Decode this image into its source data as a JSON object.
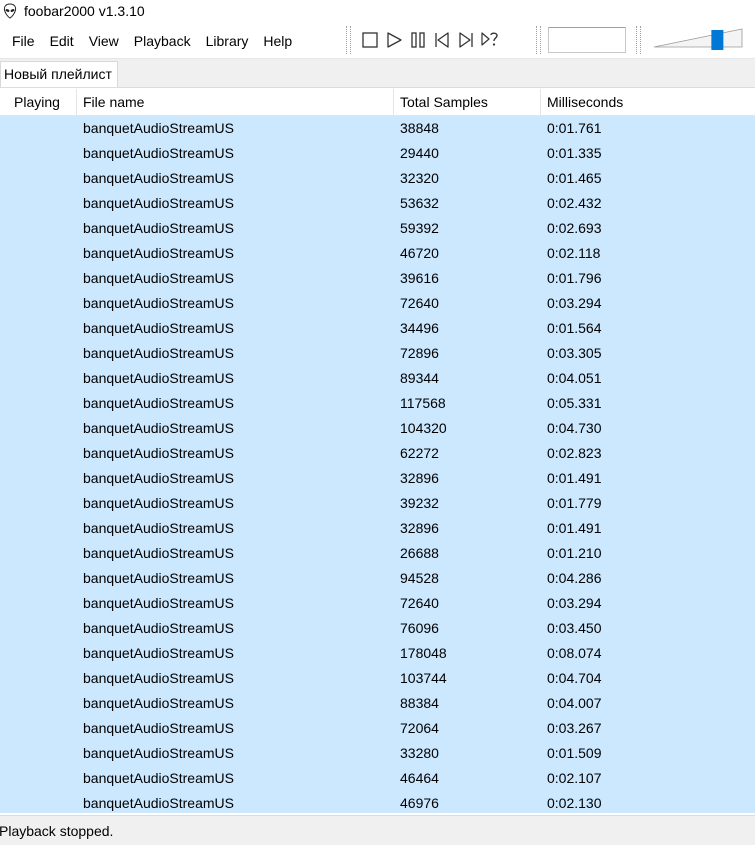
{
  "window": {
    "title": "foobar2000 v1.3.10",
    "icon": "alien-logo-icon"
  },
  "menu": {
    "items": [
      "File",
      "Edit",
      "View",
      "Playback",
      "Library",
      "Help"
    ]
  },
  "toolbar": {
    "buttons": [
      "stop-icon",
      "play-icon",
      "pause-icon",
      "previous-icon",
      "next-icon",
      "random-icon"
    ],
    "volume_level_percent": 72
  },
  "tabs": [
    {
      "label": "Новый плейлист",
      "active": true
    }
  ],
  "playlist": {
    "columns": [
      "Playing",
      "File name",
      "Total Samples",
      "Milliseconds"
    ],
    "selection_color": "#cce8ff",
    "rows": [
      {
        "playing": "",
        "file": "banquetAudioStreamUS",
        "samples": "38848",
        "ms": "0:01.761"
      },
      {
        "playing": "",
        "file": "banquetAudioStreamUS",
        "samples": "29440",
        "ms": "0:01.335"
      },
      {
        "playing": "",
        "file": "banquetAudioStreamUS",
        "samples": "32320",
        "ms": "0:01.465"
      },
      {
        "playing": "",
        "file": "banquetAudioStreamUS",
        "samples": "53632",
        "ms": "0:02.432"
      },
      {
        "playing": "",
        "file": "banquetAudioStreamUS",
        "samples": "59392",
        "ms": "0:02.693"
      },
      {
        "playing": "",
        "file": "banquetAudioStreamUS",
        "samples": "46720",
        "ms": "0:02.118"
      },
      {
        "playing": "",
        "file": "banquetAudioStreamUS",
        "samples": "39616",
        "ms": "0:01.796"
      },
      {
        "playing": "",
        "file": "banquetAudioStreamUS",
        "samples": "72640",
        "ms": "0:03.294"
      },
      {
        "playing": "",
        "file": "banquetAudioStreamUS",
        "samples": "34496",
        "ms": "0:01.564"
      },
      {
        "playing": "",
        "file": "banquetAudioStreamUS",
        "samples": "72896",
        "ms": "0:03.305"
      },
      {
        "playing": "",
        "file": "banquetAudioStreamUS",
        "samples": "89344",
        "ms": "0:04.051"
      },
      {
        "playing": "",
        "file": "banquetAudioStreamUS",
        "samples": "117568",
        "ms": "0:05.331"
      },
      {
        "playing": "",
        "file": "banquetAudioStreamUS",
        "samples": "104320",
        "ms": "0:04.730"
      },
      {
        "playing": "",
        "file": "banquetAudioStreamUS",
        "samples": "62272",
        "ms": "0:02.823"
      },
      {
        "playing": "",
        "file": "banquetAudioStreamUS",
        "samples": "32896",
        "ms": "0:01.491"
      },
      {
        "playing": "",
        "file": "banquetAudioStreamUS",
        "samples": "39232",
        "ms": "0:01.779"
      },
      {
        "playing": "",
        "file": "banquetAudioStreamUS",
        "samples": "32896",
        "ms": "0:01.491"
      },
      {
        "playing": "",
        "file": "banquetAudioStreamUS",
        "samples": "26688",
        "ms": "0:01.210"
      },
      {
        "playing": "",
        "file": "banquetAudioStreamUS",
        "samples": "94528",
        "ms": "0:04.286"
      },
      {
        "playing": "",
        "file": "banquetAudioStreamUS",
        "samples": "72640",
        "ms": "0:03.294"
      },
      {
        "playing": "",
        "file": "banquetAudioStreamUS",
        "samples": "76096",
        "ms": "0:03.450"
      },
      {
        "playing": "",
        "file": "banquetAudioStreamUS",
        "samples": "178048",
        "ms": "0:08.074"
      },
      {
        "playing": "",
        "file": "banquetAudioStreamUS",
        "samples": "103744",
        "ms": "0:04.704"
      },
      {
        "playing": "",
        "file": "banquetAudioStreamUS",
        "samples": "88384",
        "ms": "0:04.007"
      },
      {
        "playing": "",
        "file": "banquetAudioStreamUS",
        "samples": "72064",
        "ms": "0:03.267"
      },
      {
        "playing": "",
        "file": "banquetAudioStreamUS",
        "samples": "33280",
        "ms": "0:01.509"
      },
      {
        "playing": "",
        "file": "banquetAudioStreamUS",
        "samples": "46464",
        "ms": "0:02.107"
      },
      {
        "playing": "",
        "file": "banquetAudioStreamUS",
        "samples": "46976",
        "ms": "0:02.130"
      }
    ]
  },
  "status": {
    "text": "Playback stopped."
  }
}
